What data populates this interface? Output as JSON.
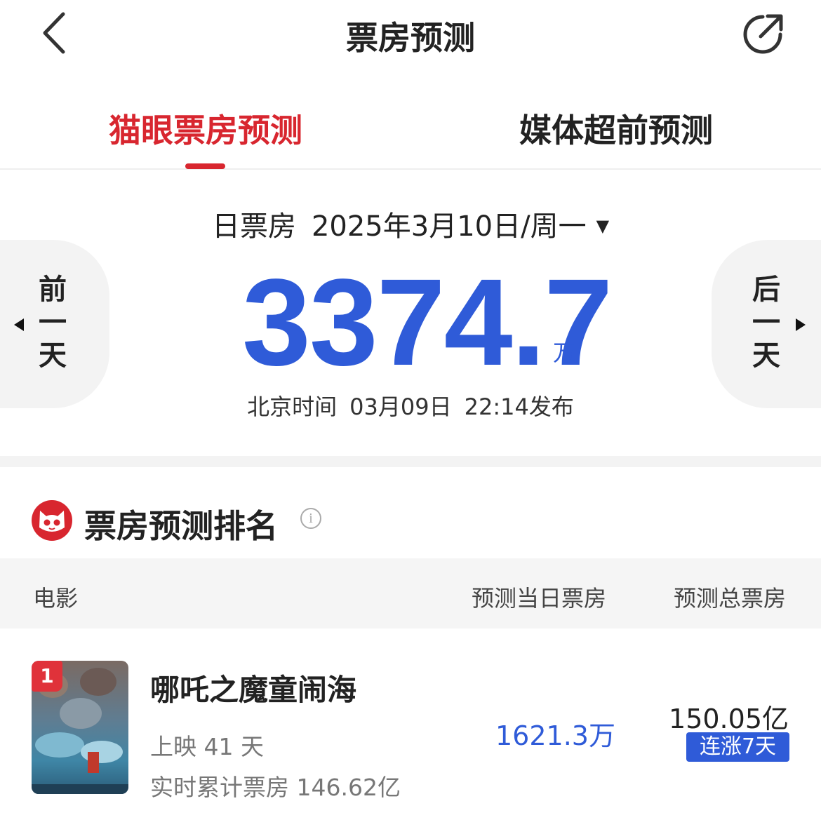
{
  "header": {
    "title": "票房预测",
    "back_icon": "chevron-left-icon",
    "share_icon": "share-icon"
  },
  "tabs": [
    {
      "label": "猫眼票房预测",
      "active": true
    },
    {
      "label": "媒体超前预测",
      "active": false
    }
  ],
  "day_section": {
    "type_label": "日票房",
    "date_label": "2025年3月10日/周一",
    "prev_label": [
      "前",
      "一",
      "天"
    ],
    "next_label": [
      "后",
      "一",
      "天"
    ],
    "forecast_value": "3374.7",
    "forecast_unit": "万",
    "publish_zone": "北京时间",
    "publish_date": "03月09日",
    "publish_time": "22:14发布"
  },
  "ranking": {
    "title": "票房预测排名",
    "columns": {
      "movie": "电影",
      "day": "预测当日票房",
      "total": "预测总票房"
    },
    "rows": [
      {
        "rank": "1",
        "name": "哪吒之魔童闹海",
        "days_showing": "上映 41 天",
        "cumulative": "实时累计票房 146.62亿",
        "day_forecast": "1621.3万",
        "total_forecast": "150.05亿",
        "streak_badge": "连涨7天"
      }
    ]
  },
  "colors": {
    "brand_red": "#d8262f",
    "accent_blue": "#2f5bd8"
  }
}
